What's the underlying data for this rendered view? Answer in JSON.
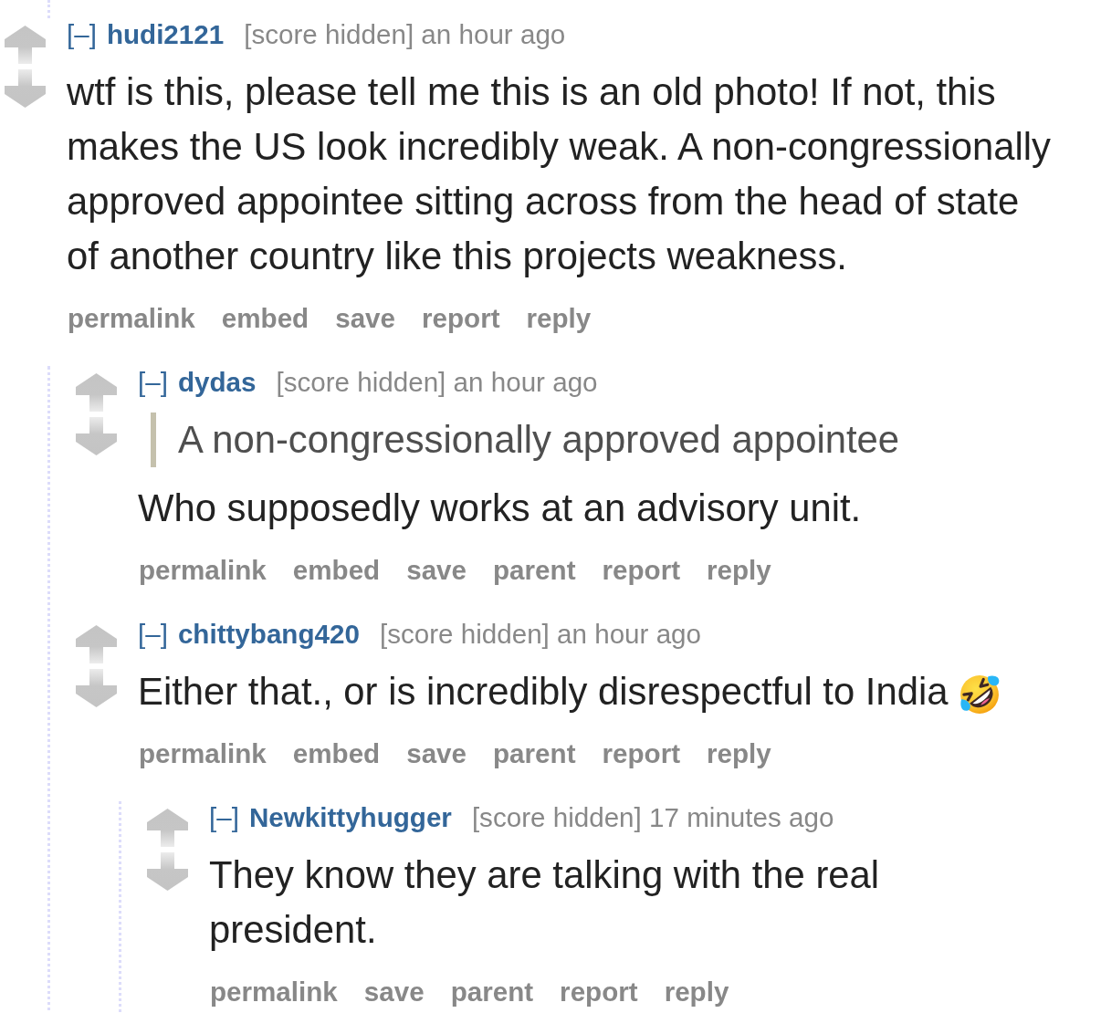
{
  "comments": [
    {
      "collapse_toggle": "[–]",
      "author": "hudi2121",
      "score": "[score hidden]",
      "time": "an hour ago",
      "body": [
        {
          "kind": "paragraph",
          "text": "wtf is this, please tell me this is an old photo! If not, this makes the US look incredibly weak. A non-congressionally approved appointee sitting across from the head of state of another country like this projects weakness.",
          "emoji": false
        }
      ],
      "buttons": [
        "permalink",
        "embed",
        "save",
        "report",
        "reply"
      ],
      "children": [
        {
          "collapse_toggle": "[–]",
          "author": "dydas",
          "score": "[score hidden]",
          "time": "an hour ago",
          "body": [
            {
              "kind": "quote",
              "text": "A non-congressionally approved appointee"
            },
            {
              "kind": "paragraph",
              "text": "Who supposedly works at an advisory unit.",
              "emoji": false
            }
          ],
          "buttons": [
            "permalink",
            "embed",
            "save",
            "parent",
            "report",
            "reply"
          ]
        },
        {
          "collapse_toggle": "[–]",
          "author": "chittybang420",
          "score": "[score hidden]",
          "time": "an hour ago",
          "body": [
            {
              "kind": "paragraph",
              "text": "Either that., or is incredibly disrespectful to India",
              "emoji": true
            }
          ],
          "buttons": [
            "permalink",
            "embed",
            "save",
            "parent",
            "report",
            "reply"
          ],
          "children": [
            {
              "collapse_toggle": "[–]",
              "author": "Newkittyhugger",
              "score": "[score hidden]",
              "time": "17 minutes ago",
              "body": [
                {
                  "kind": "paragraph",
                  "text": "They know they are talking with the real president.",
                  "emoji": false
                }
              ],
              "buttons": [
                "permalink",
                "save",
                "parent",
                "report",
                "reply"
              ]
            }
          ]
        }
      ]
    }
  ]
}
